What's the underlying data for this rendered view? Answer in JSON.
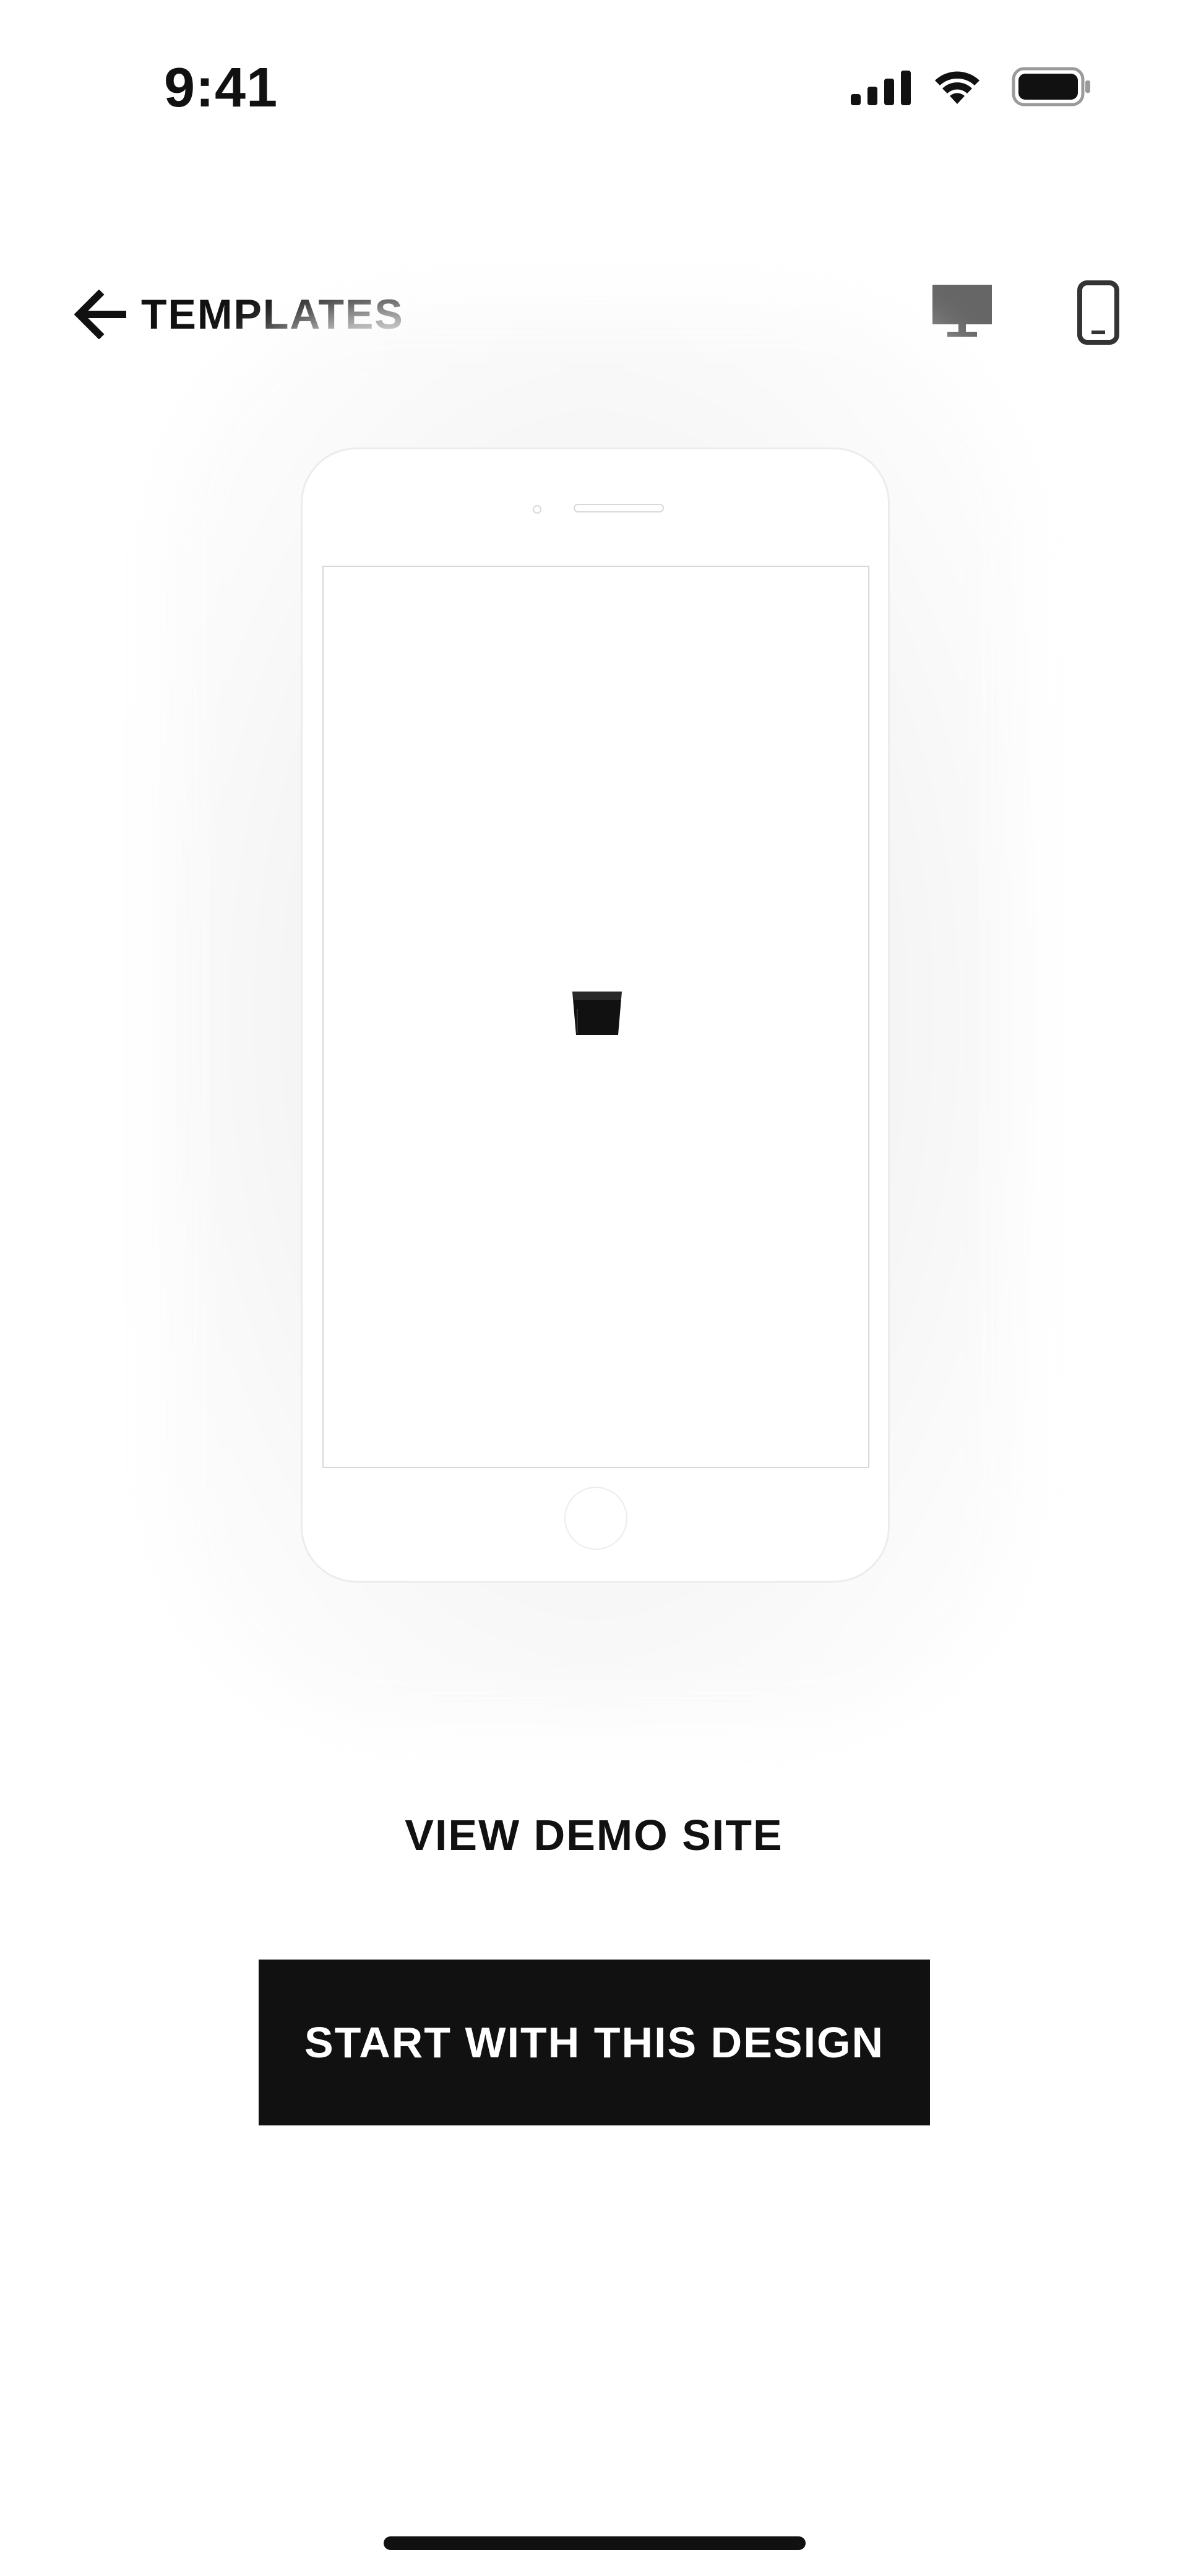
{
  "status_bar": {
    "time": "9:41",
    "icons": [
      "cellular-signal-icon",
      "wifi-icon",
      "battery-icon"
    ]
  },
  "nav": {
    "back_label": "TEMPLATES",
    "back_icon": "arrow-left-icon",
    "view_modes": [
      {
        "name": "desktop",
        "icon": "desktop-monitor-icon",
        "selected": false
      },
      {
        "name": "mobile",
        "icon": "mobile-phone-icon",
        "selected": true
      }
    ]
  },
  "preview": {
    "device": "phone",
    "state": "loading",
    "glyph_icon": "loading-icon"
  },
  "actions": {
    "view_demo_label": "VIEW DEMO SITE",
    "start_label": "START WITH THIS DESIGN"
  },
  "colors": {
    "text": "#111111",
    "button_background": "#111111",
    "button_text": "#ffffff",
    "inactive_icon": "#666666",
    "background": "#ffffff"
  }
}
